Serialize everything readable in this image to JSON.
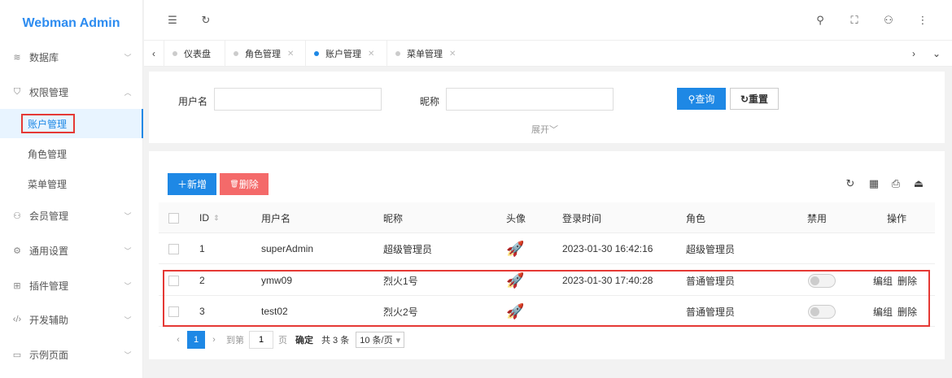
{
  "app": {
    "title": "Webman Admin"
  },
  "sidebar": {
    "items": [
      {
        "icon": "database-icon",
        "label": "数据库"
      },
      {
        "icon": "shield-icon",
        "label": "权限管理"
      },
      {
        "icon": "user-icon",
        "label": "会员管理"
      },
      {
        "icon": "gear-icon",
        "label": "通用设置"
      },
      {
        "icon": "plugin-icon",
        "label": "插件管理"
      },
      {
        "icon": "code-icon",
        "label": "开发辅助"
      },
      {
        "icon": "page-icon",
        "label": "示例页面"
      }
    ],
    "sub_items": [
      "账户管理",
      "角色管理",
      "菜单管理"
    ],
    "active": "账户管理"
  },
  "tabs": [
    {
      "label": "仪表盘",
      "closable": false
    },
    {
      "label": "角色管理",
      "closable": true
    },
    {
      "label": "账户管理",
      "closable": true,
      "active": true
    },
    {
      "label": "菜单管理",
      "closable": true
    }
  ],
  "search": {
    "username_label": "用户名",
    "nickname_label": "昵称",
    "username_value": "",
    "nickname_value": "",
    "query_label": "查询",
    "reset_label": "重置",
    "expand_label": "展开"
  },
  "toolbar": {
    "add_label": "新增",
    "delete_label": "删除"
  },
  "table": {
    "columns": [
      "ID",
      "用户名",
      "昵称",
      "头像",
      "登录时间",
      "角色",
      "禁用",
      "操作"
    ],
    "rows": [
      {
        "id": "1",
        "username": "superAdmin",
        "nickname": "超级管理员",
        "login_time": "2023-01-30 16:42:16",
        "role": "超级管理员",
        "has_toggle": false,
        "actions": []
      },
      {
        "id": "2",
        "username": "ymw09",
        "nickname": "烈火1号",
        "login_time": "2023-01-30 17:40:28",
        "role": "普通管理员",
        "has_toggle": true,
        "actions": [
          "编组",
          "删除"
        ]
      },
      {
        "id": "3",
        "username": "test02",
        "nickname": "烈火2号",
        "login_time": "",
        "role": "普通管理员",
        "has_toggle": true,
        "actions": [
          "编组",
          "删除"
        ]
      }
    ]
  },
  "pagination": {
    "current_page": "1",
    "goto_label": "到第",
    "goto_value": "1",
    "page_unit": "页",
    "confirm_label": "确定",
    "total_label": "共 3 条",
    "page_size_label": "10 条/页"
  },
  "colors": {
    "accent": "#1e88e5",
    "danger": "#f46a6a",
    "highlight": "#e53935"
  }
}
